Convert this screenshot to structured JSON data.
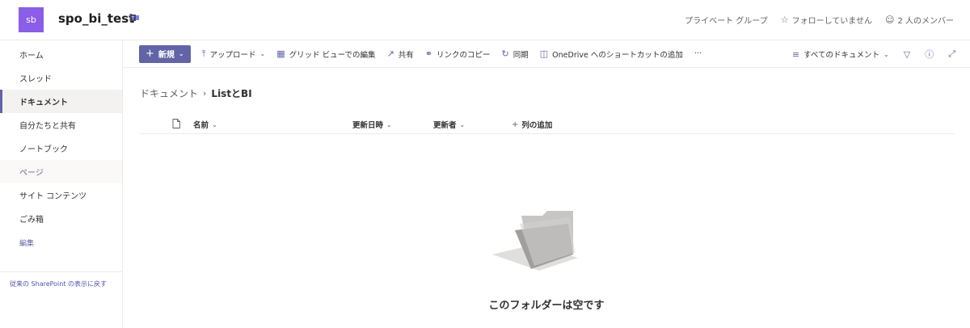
{
  "header": {
    "logo_initials": "sb",
    "site_title": "spo_bi_test",
    "privacy": "プライベート グループ",
    "follow": "フォローしていません",
    "members": "2 人のメンバー"
  },
  "leftnav": {
    "items": [
      {
        "label": "ホーム"
      },
      {
        "label": "スレッド"
      },
      {
        "label": "ドキュメント"
      },
      {
        "label": "自分たちと共有"
      },
      {
        "label": "ノートブック"
      },
      {
        "label": "ページ"
      },
      {
        "label": "サイト コンテンツ"
      },
      {
        "label": "ごみ箱"
      }
    ],
    "edit": "編集",
    "classic": "従来の SharePoint の表示に戻す"
  },
  "commandbar": {
    "new": "新規",
    "upload": "アップロード",
    "grid": "グリッド ビューでの編集",
    "share": "共有",
    "copylink": "リンクのコピー",
    "sync": "同期",
    "shortcut": "OneDrive へのショートカットの追加",
    "more": "···",
    "view": "すべてのドキュメント"
  },
  "breadcrumb": {
    "parent": "ドキュメント",
    "current": "ListとBI"
  },
  "columns": {
    "name": "名前",
    "modified": "更新日時",
    "modified_by": "更新者",
    "add_column": "列の追加"
  },
  "empty": {
    "message": "このフォルダーは空です"
  },
  "colors": {
    "accent": "#6264a7",
    "logo_bg": "#8a5ee6"
  }
}
